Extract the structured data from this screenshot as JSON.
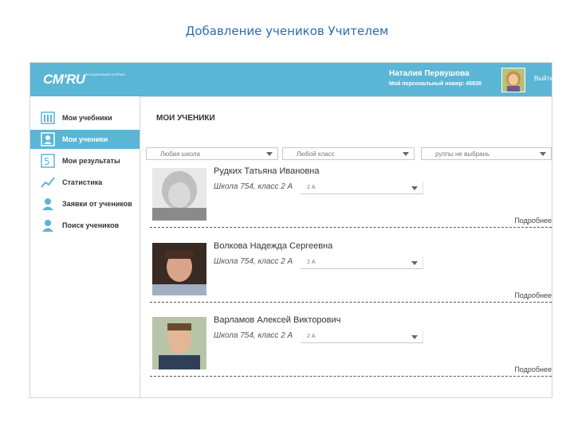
{
  "slide_title": "Добавление учеников Учителем",
  "header": {
    "logo": "СМ'RU",
    "logo_sub": "интерактивный учебник",
    "user_name": "Наталия Первушова",
    "user_number": "Мой персональный номер: 45838",
    "logout": "Выйти",
    "accent": "#5bb5d5"
  },
  "sidebar": {
    "items": [
      {
        "label": "Мои учебники",
        "icon": "books-icon"
      },
      {
        "label": "Мои ученики",
        "icon": "students-icon",
        "active": true
      },
      {
        "label": "Мои результаты",
        "icon": "results-icon"
      },
      {
        "label": "Статистика",
        "icon": "chart-icon"
      },
      {
        "label": "Заявки от учеников",
        "icon": "requests-icon"
      },
      {
        "label": "Поиск учеников",
        "icon": "search-students-icon"
      }
    ]
  },
  "main": {
    "title": "МОИ УЧЕНИКИ",
    "filters": [
      {
        "value": "Любая школа"
      },
      {
        "value": "Любой класс"
      },
      {
        "value": "руппы не выбрань"
      }
    ],
    "students": [
      {
        "name": "Рудких Татьяна Ивановна",
        "school": "Школа 754, класс 2 А",
        "class_select": "2 А",
        "more": "Подробнее"
      },
      {
        "name": "Волкова Надежда Сергеевна",
        "school": "Школа 754, класс 2 А",
        "class_select": "2 А",
        "more": "Подробнее"
      },
      {
        "name": "Варламов Алексей Викторович",
        "school": "Школа 754, класс 2 А",
        "class_select": "2 А",
        "more": "Подробнее"
      }
    ]
  }
}
